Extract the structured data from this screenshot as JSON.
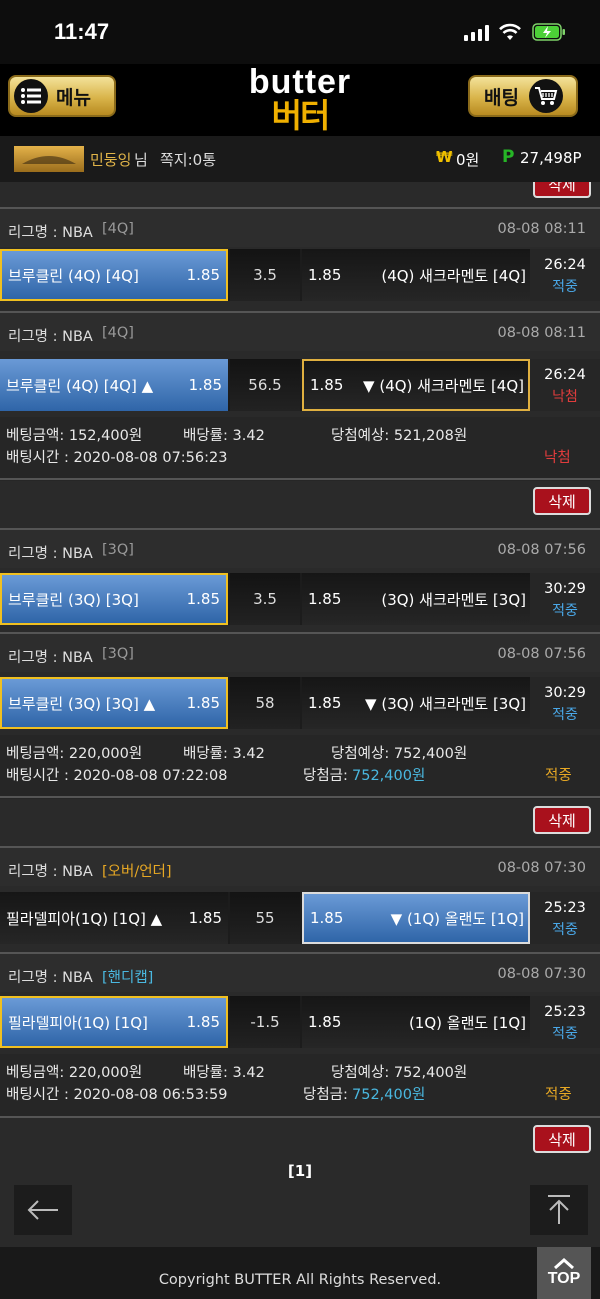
{
  "status": {
    "time": "11:47"
  },
  "header": {
    "menu_label": "메뉴",
    "logo_en": "butter",
    "logo_ko": "버터",
    "bet_label": "배팅"
  },
  "user": {
    "name": "민둥잉",
    "suffix": "님",
    "messages": "쪽지:0통",
    "won_icon": "₩",
    "balance": "0원",
    "point_icon": "P",
    "points": "27,498P"
  },
  "delete_label": "삭제",
  "bets": [
    {
      "games": [
        {
          "league": "리그명 : NBA",
          "tag": "[4Q]",
          "tag_color": "#999999",
          "datetime": "08-08 08:11",
          "home": "브루클린 (4Q) [4Q]",
          "home_odds": "1.85",
          "mid": "3.5",
          "away_odds": "1.85",
          "away": "(4Q) 새크라멘토 [4Q]",
          "clock": "26:24",
          "status": "적중"
        },
        {
          "league": "리그명 : NBA",
          "tag": "[4Q]",
          "tag_color": "#999999",
          "datetime": "08-08 08:11",
          "home": "브루클린 (4Q) [4Q] ▲",
          "home_odds": "1.85",
          "mid": "56.5",
          "away_odds": "1.85",
          "away": "▼ (4Q) 새크라멘토 [4Q]",
          "clock": "26:24",
          "status": "낙첨"
        }
      ],
      "info": {
        "amount": "베팅금액: 152,400원",
        "rate": "배당률: 3.42",
        "expected": "당첨예상: 521,208원",
        "time": "배팅시간 : 2020-08-08 07:56:23",
        "win": "",
        "result": "낙첨"
      }
    },
    {
      "games": [
        {
          "league": "리그명 : NBA",
          "tag": "[3Q]",
          "tag_color": "#999999",
          "datetime": "08-08 07:56",
          "home": "브루클린 (3Q) [3Q]",
          "home_odds": "1.85",
          "mid": "3.5",
          "away_odds": "1.85",
          "away": "(3Q) 새크라멘토 [3Q]",
          "clock": "30:29",
          "status": "적중"
        },
        {
          "league": "리그명 : NBA",
          "tag": "[3Q]",
          "tag_color": "#999999",
          "datetime": "08-08 07:56",
          "home": "브루클린 (3Q) [3Q] ▲",
          "home_odds": "1.85",
          "mid": "58",
          "away_odds": "1.85",
          "away": "▼ (3Q) 새크라멘토 [3Q]",
          "clock": "30:29",
          "status": "적중"
        }
      ],
      "info": {
        "amount": "베팅금액: 220,000원",
        "rate": "배당률: 3.42",
        "expected": "당첨예상: 752,400원",
        "time": "배팅시간 : 2020-08-08 07:22:08",
        "win_label": "당첨금:",
        "win": "752,400원",
        "result": "적중"
      }
    },
    {
      "games": [
        {
          "league": "리그명 : NBA",
          "tag": "[오버/언더]",
          "tag_color": "#e7a824",
          "datetime": "08-08 07:30",
          "home": "필라델피아(1Q) [1Q] ▲",
          "home_odds": "1.85",
          "mid": "55",
          "away_odds": "1.85",
          "away": "▼ (1Q) 올랜도 [1Q]",
          "clock": "25:23",
          "status": "적중"
        },
        {
          "league": "리그명 : NBA",
          "tag": "[핸디캡]",
          "tag_color": "#4ab8e0",
          "datetime": "08-08 07:30",
          "home": "필라델피아(1Q) [1Q]",
          "home_odds": "1.85",
          "mid": "-1.5",
          "away_odds": "1.85",
          "away": "(1Q) 올랜도 [1Q]",
          "clock": "25:23",
          "status": "적중"
        }
      ],
      "info": {
        "amount": "베팅금액: 220,000원",
        "rate": "배당률: 3.42",
        "expected": "당첨예상: 752,400원",
        "time": "배팅시간 : 2020-08-08 06:53:59",
        "win_label": "당첨금:",
        "win": "752,400원",
        "result": "적중"
      }
    }
  ],
  "pager": "[1]",
  "footer": {
    "copyright": "Copyright BUTTER All Rights Reserved.",
    "top_label": "TOP"
  }
}
